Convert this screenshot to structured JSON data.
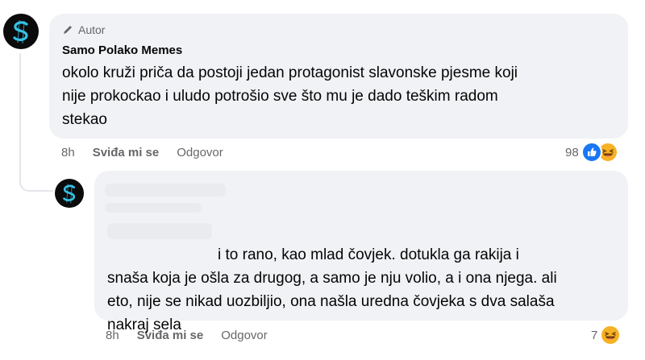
{
  "comment1": {
    "badge_label": "Autor",
    "author": "Samo Polako Memes",
    "text": "okolo kruži priča da postoji jedan protagonist slavonske pjesme koji\nnije prokockao i uludo potrošio sve što mu je dado teškim radom\nstekao",
    "time": "8h",
    "like_label": "Sviđa mi se",
    "reply_label": "Odgovor",
    "reaction_count": "98",
    "reactions": [
      "like-reaction",
      "haha-reaction"
    ]
  },
  "comment2": {
    "author_hidden": true,
    "text": "i to rano, kao mlad čovjek. dotukla ga rakija i\nsnaša koja je ošla za drugog, a samo je nju volio, a i ona njega. ali\neto, nije se nikad uozbiljio, ona našla uredna čovjeka s dva salaša\nnakraj sela",
    "time": "8h",
    "like_label": "Sviđa mi se",
    "reply_label": "Odgovor",
    "reaction_count": "7",
    "reactions": [
      "haha-reaction"
    ]
  },
  "colors": {
    "bubble": "#f0f2f5",
    "secondary_text": "#65676b",
    "like_blue": "#1877f2",
    "haha_yellow": "#f7b125",
    "avatar_accent": "#36c3e6"
  }
}
